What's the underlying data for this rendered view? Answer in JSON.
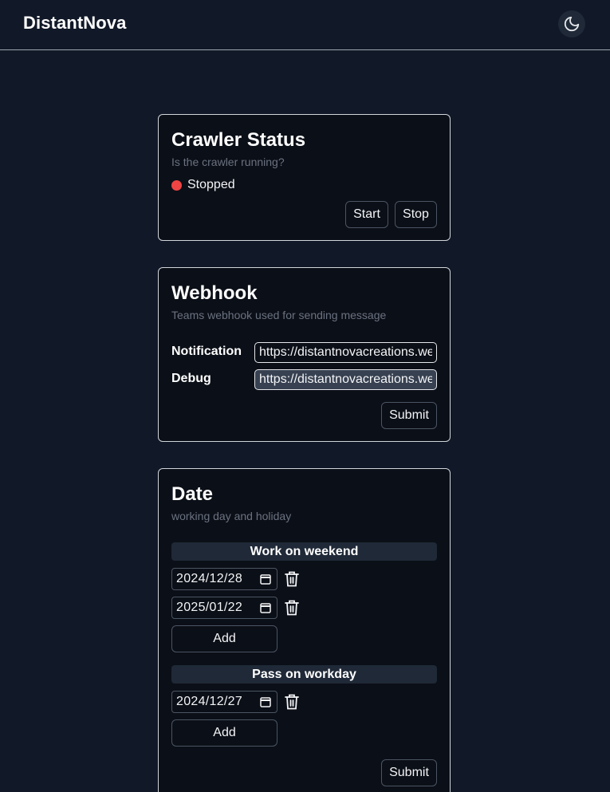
{
  "app": {
    "brand": "DistantNova"
  },
  "icons": {
    "theme_toggle": "moon-icon",
    "delete": "trash-icon",
    "calendar": "calendar-icon"
  },
  "colors": {
    "status_stopped": "#ef4444",
    "background": "#111827",
    "card": "#0b0f17"
  },
  "crawler": {
    "title": "Crawler Status",
    "subtitle": "Is the crawler running?",
    "status": "Stopped",
    "start_label": "Start",
    "stop_label": "Stop"
  },
  "webhook": {
    "title": "Webhook",
    "subtitle": "Teams webhook used for sending message",
    "notification_label": "Notification",
    "notification_value": "https://distantnovacreations.webhook.office.com",
    "debug_label": "Debug",
    "debug_value": "https://distantnovacreations.webhook.office.com",
    "submit_label": "Submit"
  },
  "date": {
    "title": "Date",
    "subtitle": "working day and holiday",
    "weekend": {
      "heading": "Work on weekend",
      "dates": [
        "2024/12/28",
        "2025/01/22"
      ],
      "add_label": "Add"
    },
    "workday": {
      "heading": "Pass on workday",
      "dates": [
        "2024/12/27"
      ],
      "add_label": "Add"
    },
    "submit_label": "Submit"
  }
}
